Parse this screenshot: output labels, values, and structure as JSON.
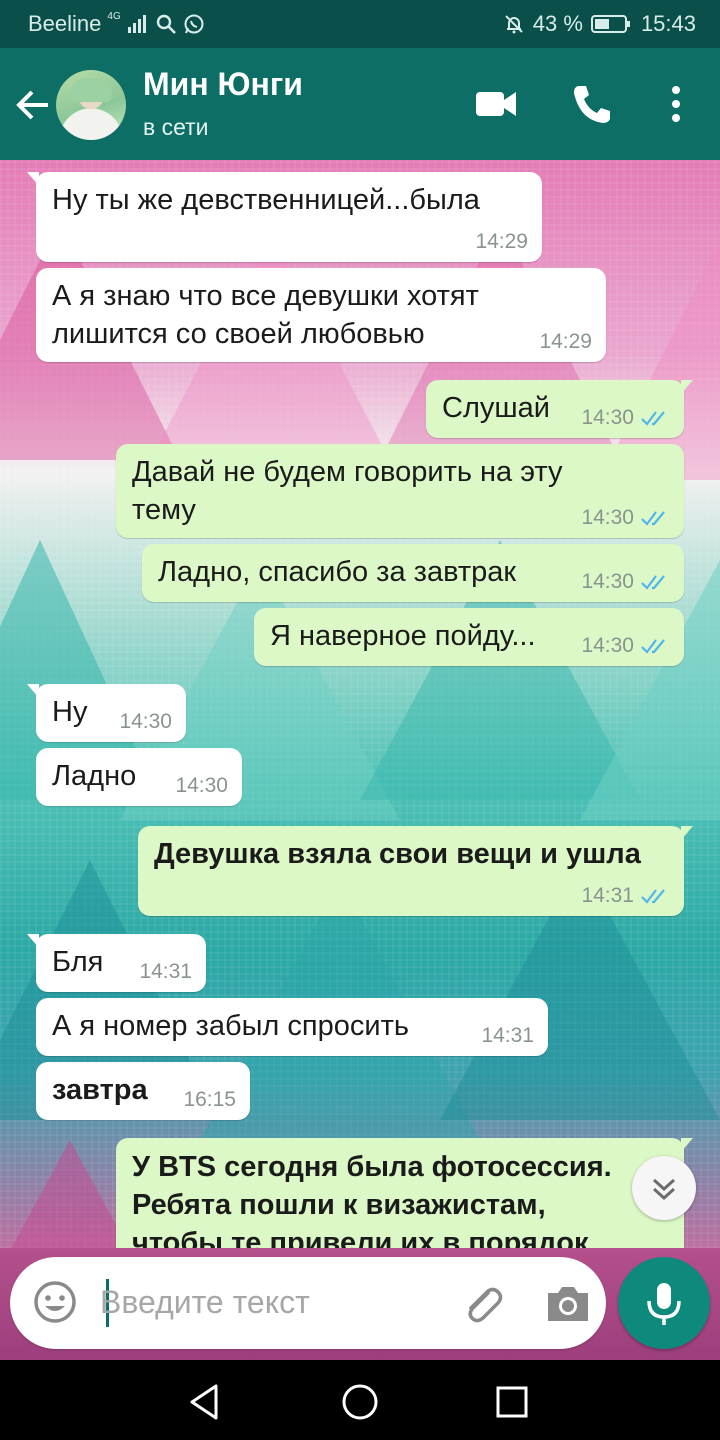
{
  "status_bar": {
    "carrier": "Beeline",
    "network": "4G",
    "battery": "43 %",
    "time": "15:43"
  },
  "header": {
    "contact_name": "Мин Юнги",
    "contact_status": "в сети",
    "icons": [
      "back-arrow-icon",
      "video-call-icon",
      "phone-icon",
      "more-vert-icon"
    ]
  },
  "messages": [
    {
      "dir": "in",
      "lines": [
        "Ну ты же девственницей...была"
      ],
      "time": "14:29",
      "bold": false
    },
    {
      "dir": "in",
      "lines": [
        "А я знаю что все девушки хотят",
        "лишится со своей любовью"
      ],
      "time": "14:29",
      "bold": false
    },
    {
      "dir": "out",
      "lines": [
        "Слушай"
      ],
      "time": "14:30",
      "bold": false
    },
    {
      "dir": "out",
      "lines": [
        "Давай не будем говорить на эту",
        "тему"
      ],
      "time": "14:30",
      "bold": false
    },
    {
      "dir": "out",
      "lines": [
        "Ладно, спасибо за завтрак"
      ],
      "time": "14:30",
      "bold": false
    },
    {
      "dir": "out",
      "lines": [
        "Я наверное пойду..."
      ],
      "time": "14:30",
      "bold": false
    },
    {
      "dir": "in",
      "lines": [
        "Ну"
      ],
      "time": "14:30",
      "bold": false
    },
    {
      "dir": "in",
      "lines": [
        "Ладно"
      ],
      "time": "14:30",
      "bold": false
    },
    {
      "dir": "out",
      "lines": [
        "Девушка взяла свои вещи и ушла"
      ],
      "time": "14:31",
      "bold": true
    },
    {
      "dir": "in",
      "lines": [
        "Бля"
      ],
      "time": "14:31",
      "bold": false
    },
    {
      "dir": "in",
      "lines": [
        "А я номер забыл спросить"
      ],
      "time": "14:31",
      "bold": false
    },
    {
      "dir": "in",
      "lines": [
        "завтра"
      ],
      "time": "16:15",
      "bold": true
    },
    {
      "dir": "out",
      "lines": [
        "У BTS сегодня была фотосессия.",
        "Ребята пошли к визажистам,",
        "чтобы те привели их в порядок"
      ],
      "time": "",
      "bold": true
    }
  ],
  "input": {
    "placeholder": "Введите текст",
    "value": ""
  },
  "colors": {
    "header": "#0d6e66",
    "status_bar": "#0a4f49",
    "outgoing_bubble": "#dcf8c6",
    "incoming_bubble": "#ffffff",
    "read_ticks": "#4fb6ec",
    "mic_button": "#0d8a7c"
  },
  "icons": {
    "input_bar": [
      "emoji-icon",
      "paperclip-icon",
      "camera-icon",
      "mic-icon"
    ],
    "nav": [
      "back-triangle-icon",
      "home-circle-icon",
      "recents-square-icon"
    ],
    "scroll": "chevron-double-down-icon"
  }
}
